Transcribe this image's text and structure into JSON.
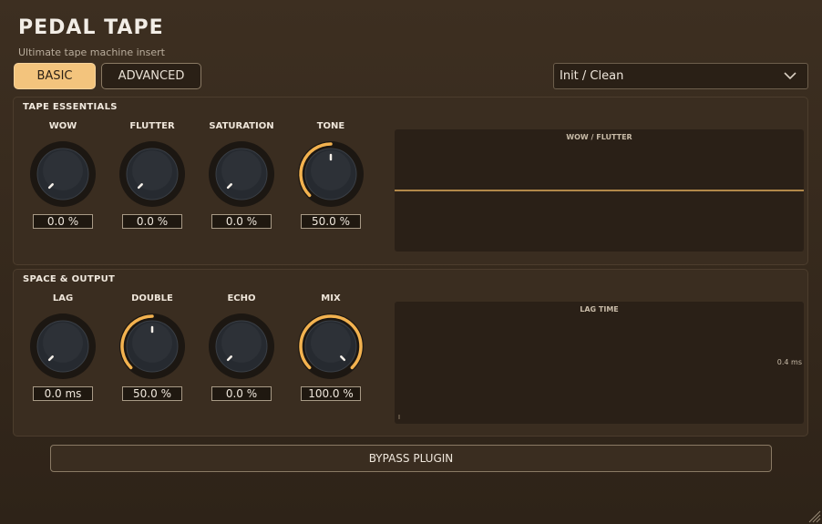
{
  "app": {
    "title": "PEDAL TAPE",
    "subtitle": "Ultimate tape machine insert"
  },
  "tabs": [
    {
      "label": "BASIC",
      "active": true
    },
    {
      "label": "ADVANCED",
      "active": false
    }
  ],
  "preset": {
    "selected": "Init / Clean",
    "icon": "chevron-down-icon"
  },
  "colors": {
    "accent": "#f3b24f",
    "panel": "#3a2d20",
    "display_bg": "#2a2017",
    "active_tab": "#f3c47d"
  },
  "sections": {
    "essentials": {
      "title": "TAPE ESSENTIALS",
      "knobs": [
        {
          "label": "WOW",
          "value": "0.0 %",
          "fraction": 0
        },
        {
          "label": "FLUTTER",
          "value": "0.0 %",
          "fraction": 0
        },
        {
          "label": "SATURATION",
          "value": "0.0 %",
          "fraction": 0
        },
        {
          "label": "TONE",
          "value": "50.0 %",
          "fraction": 0.5
        }
      ],
      "display": {
        "title": "WOW / FLUTTER"
      }
    },
    "space": {
      "title": "SPACE & OUTPUT",
      "knobs": [
        {
          "label": "LAG",
          "value": "0.0 ms",
          "fraction": 0
        },
        {
          "label": "DOUBLE",
          "value": "50.0 %",
          "fraction": 0.5
        },
        {
          "label": "ECHO",
          "value": "0.0 %",
          "fraction": 0
        },
        {
          "label": "MIX",
          "value": "100.0 %",
          "fraction": 1
        }
      ],
      "display": {
        "title": "LAG TIME",
        "readout": "0.4 ms"
      }
    }
  },
  "bypass": {
    "label": "BYPASS PLUGIN"
  }
}
